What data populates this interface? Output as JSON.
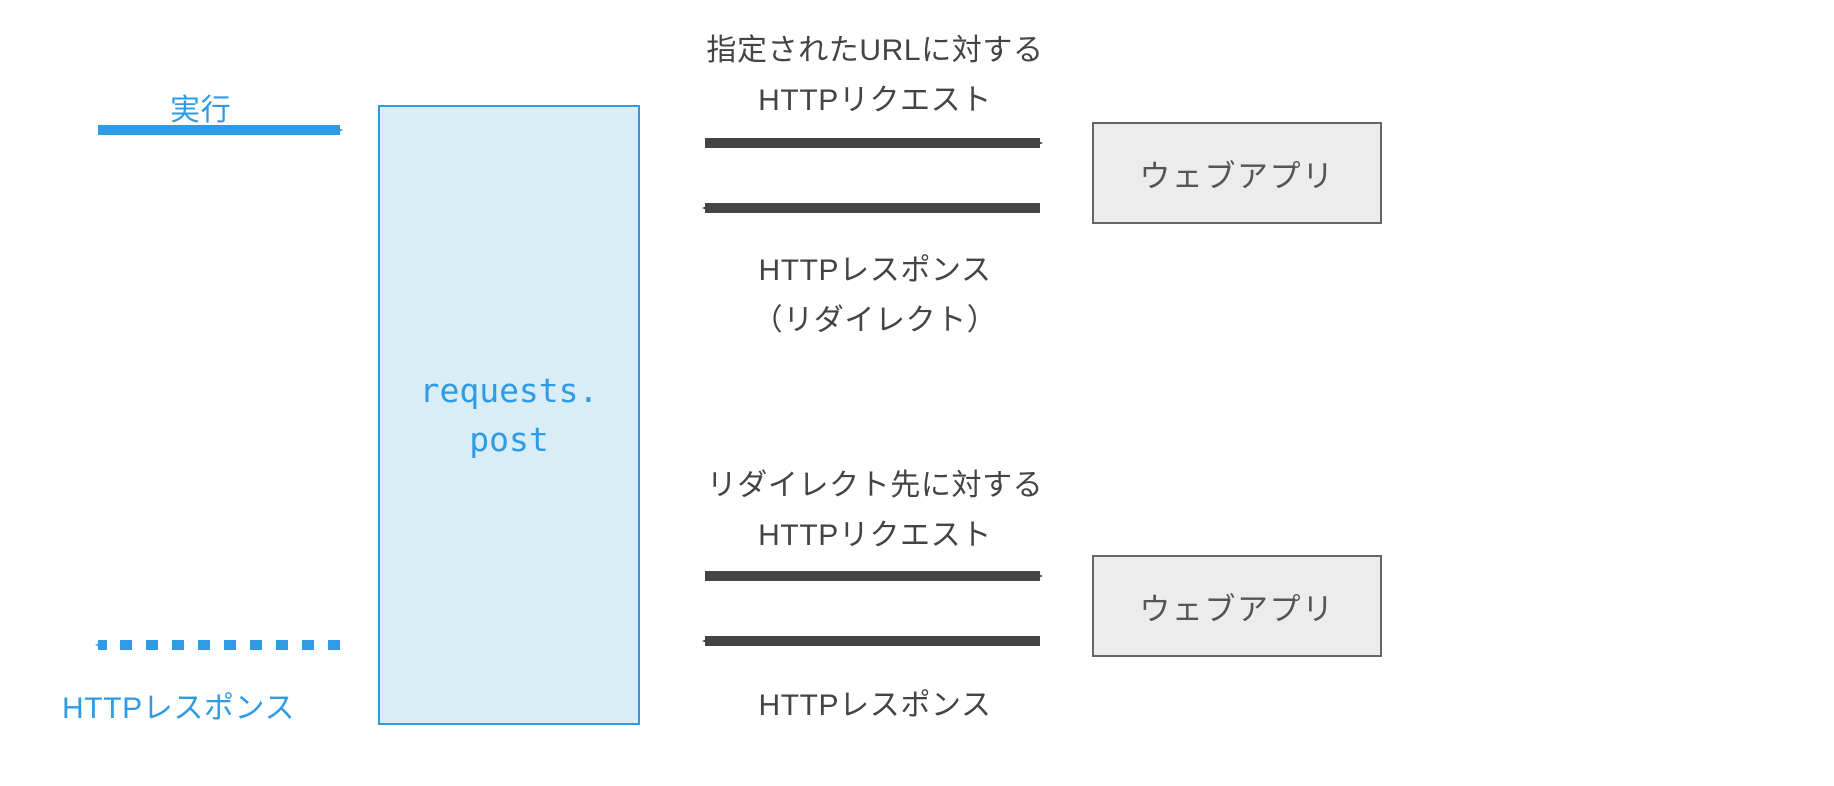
{
  "left": {
    "execute_label": "実行",
    "response_label": "HTTPレスポンス"
  },
  "center_box": {
    "line1": "requests.",
    "line2": "post"
  },
  "top_flow": {
    "request_line1": "指定されたURLに対する",
    "request_line2": "HTTPリクエスト",
    "response_line1": "HTTPレスポンス",
    "response_line2": "（リダイレクト）"
  },
  "bottom_flow": {
    "request_line1": "リダイレクト先に対する",
    "request_line2": "HTTPリクエスト",
    "response_line1": "HTTPレスポンス"
  },
  "webapp_label": "ウェブアプリ",
  "colors": {
    "blue": "#2f9be4",
    "light_blue_bg": "#d8edf5",
    "gray_box_bg": "#ececec",
    "gray_border": "#666666",
    "gray_text": "#444444",
    "arrow_gray": "#444444"
  }
}
